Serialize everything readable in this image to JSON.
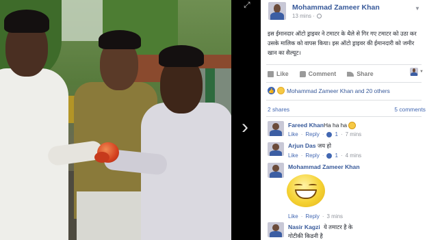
{
  "post": {
    "author": "Mohammad Zameer Khan",
    "timestamp": "13 mins ·",
    "text": "इस ईमानदार ऑटो ड्राइवर ने टमाटर के थैले से गिर गए टमाटर को उठा कर उसके मालिक को वापस किया। इस ऑटो ड्राइवर की ईमानदारी को जमीर खान का सैल्यूट।"
  },
  "actions": {
    "like": "Like",
    "comment": "Comment",
    "share": "Share"
  },
  "reactions": {
    "text": "Mohammad Zameer Khan and 20 others"
  },
  "stats": {
    "shares": "2 shares",
    "comments": "5 comments"
  },
  "comments": [
    {
      "name": "Fareed Khan",
      "text": "Ha ha ha",
      "like": "Like",
      "reply": "Reply",
      "likes": "1",
      "time": "7 mins"
    },
    {
      "name": "Arjun Das",
      "text": "जय हो",
      "like": "Like",
      "reply": "Reply",
      "likes": "1",
      "time": "4 mins"
    },
    {
      "name": "Mohammad Zameer Khan",
      "text": "",
      "like": "Like",
      "reply": "Reply",
      "time": "3 mins"
    },
    {
      "name": "Nasir Kagzi",
      "text": "ये तमाटर है के",
      "text2": "गोटीकी किडनी है"
    }
  ],
  "nav": {
    "next": "›",
    "expand": "⤢"
  },
  "colors": {
    "link": "#365899",
    "accent": "#4267b2",
    "panel_bg": "#ffffff"
  }
}
